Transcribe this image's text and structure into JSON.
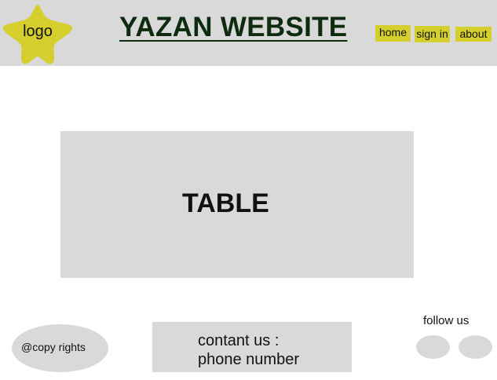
{
  "header": {
    "logo_label": "logo",
    "title": "YAZAN WEBSITE",
    "nav": {
      "home": "home",
      "sign_in": "sign in",
      "about": "about"
    }
  },
  "main": {
    "table_label": "TABLE"
  },
  "footer": {
    "copyright": "@copy rights",
    "contact_line_1": "contant us :",
    "contact_line_2": "phone number",
    "follow_label": "follow us"
  },
  "colors": {
    "panel_gray": "#d9d9d9",
    "accent_yellow": "#d4cf2d",
    "title_green": "#0e2b10"
  }
}
